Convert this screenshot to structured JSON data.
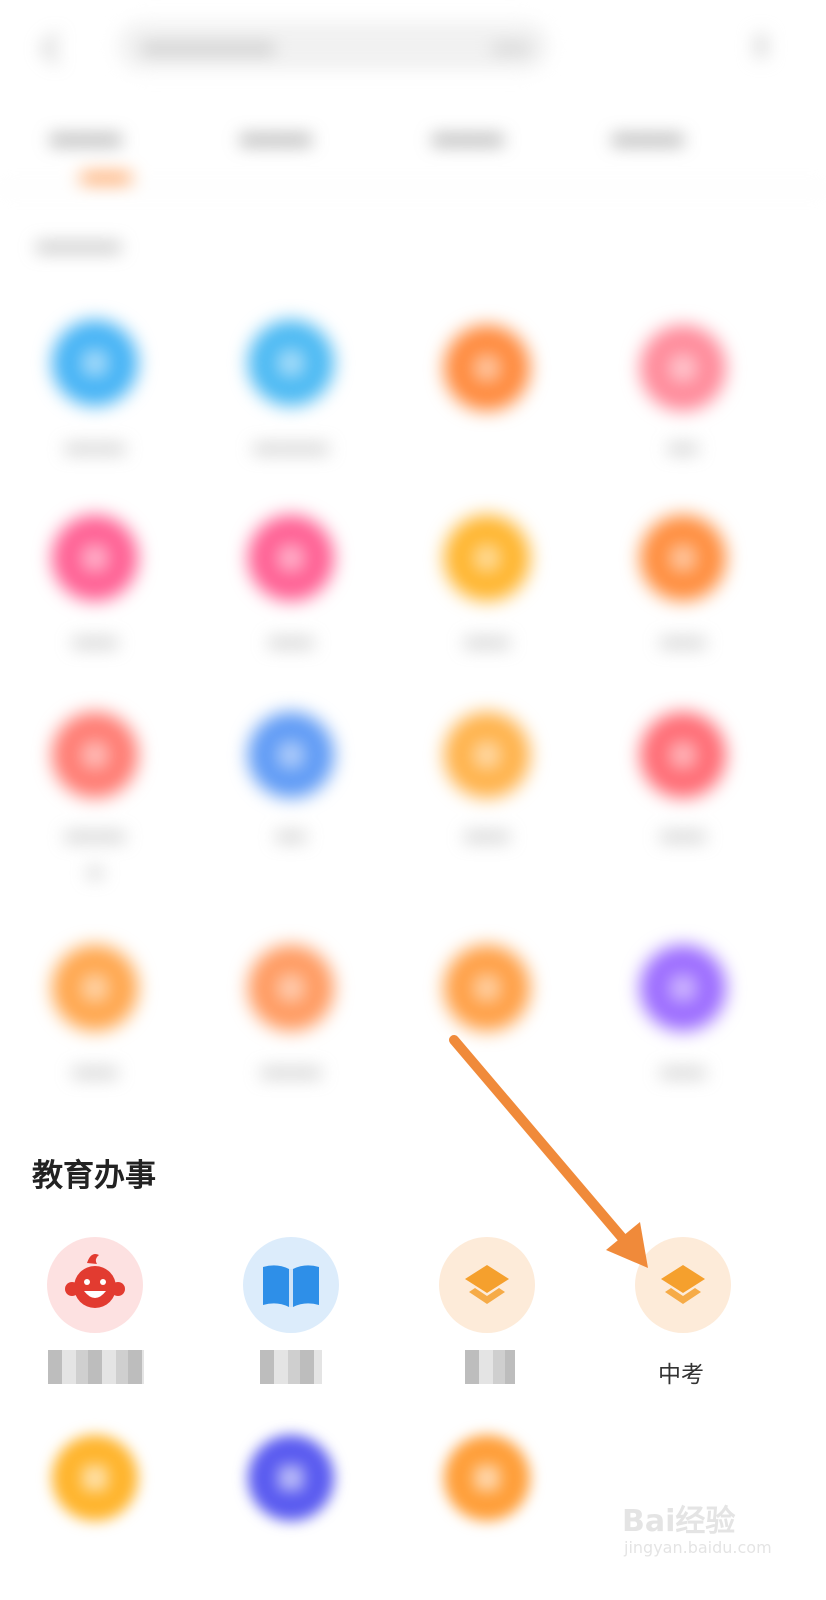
{
  "section": {
    "title": "教育办事"
  },
  "items": [
    {
      "label": "中考",
      "icon": "layers-icon"
    }
  ],
  "icons": {
    "item1": "baby-face-icon",
    "item2": "open-book-icon",
    "item3": "layers-icon",
    "item4": "layers-icon"
  },
  "colors": {
    "accent": "#ff7a1a",
    "arrow": "#f08a3a",
    "red_face": "#e23b30",
    "blue_book": "#2e8fe8",
    "orange_layer": "#f5a02d"
  },
  "watermark": {
    "brand": "Bai经验",
    "domain": "jingyan.baidu.com"
  }
}
